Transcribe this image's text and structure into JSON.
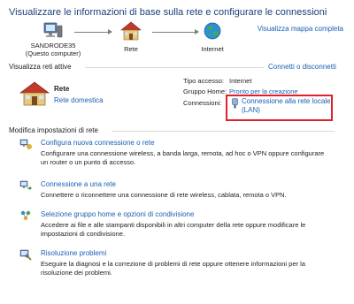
{
  "header": {
    "title": "Visualizzare le informazioni di base sulla rete e configurare le connessioni",
    "map_link": "Visualizza mappa completa"
  },
  "network_map": {
    "computer_label_1": "SANDRODE35",
    "computer_label_2": "(Questo computer)",
    "network_label": "Rete",
    "internet_label": "Internet"
  },
  "active_networks": {
    "heading": "Visualizza reti attive",
    "action_link": "Connetti o disconnetti",
    "network_name": "Rete",
    "network_type_link": "Rete domestica",
    "access_type_label": "Tipo accesso:",
    "access_type_value": "Internet",
    "home_group_label": "Gruppo Home:",
    "home_group_value": "Pronto per la creazione",
    "connections_label": "Connessioni:",
    "connection_value_line1": "Connessione alla rete locale",
    "connection_value_line2": "(LAN)"
  },
  "settings": {
    "heading": "Modifica impostazioni di rete",
    "tasks": [
      {
        "link": "Configura nuova connessione o rete",
        "desc": "Configurare una connessione wireless, a banda larga, remota, ad hoc o VPN oppure configurare un router o un punto di accesso."
      },
      {
        "link": "Connessione a una rete",
        "desc": "Connettere o riconnettere una connessione di rete wireless, cablata, remota o VPN."
      },
      {
        "link": "Selezione gruppo home e opzioni di condivisione",
        "desc": "Accedere ai file e alle stampanti disponibili in altri computer della rete oppure modificare le impostazioni di condivisione."
      },
      {
        "link": "Risoluzione problemi",
        "desc": "Eseguire la diagnosi e la correzione di problemi di rete oppure ottenere informazioni per la risoluzione dei problemi."
      }
    ]
  },
  "colors": {
    "link": "#1a5fb4",
    "title": "#1a3f7a",
    "highlight": "#e0202a"
  }
}
